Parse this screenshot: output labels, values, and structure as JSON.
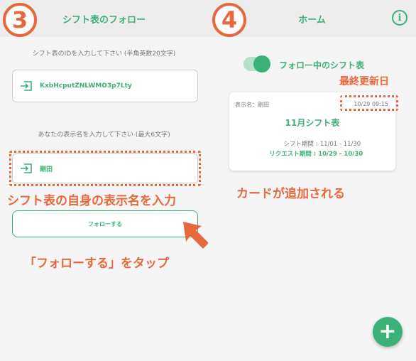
{
  "colors": {
    "accent": "#3bb078",
    "annotation": "#e8683e",
    "header_bg": "#ededed",
    "panel_bg": "#f5f5f5"
  },
  "left": {
    "step_number": "3",
    "header_title": "シフト表のフォロー",
    "back_icon": "chevron-left-icon",
    "id_field_label": "シフト表のIDを入力して下さい (半角英数20文字)",
    "id_value": "KxbHcputZNLWMO3p7Lty",
    "name_field_label": "あなたの表示名を入力して下さい (最大6文字)",
    "name_value": "剛田",
    "input_icon": "login-arrow-icon",
    "annotation_name": "シフト表の自身の表示名を入力",
    "follow_button_label": "フォローする",
    "annotation_tap": "「フォローする」をタップ"
  },
  "right": {
    "step_number": "4",
    "header_title": "ホーム",
    "info_icon": "info-icon",
    "toggle_label": "フォロー中のシフト表",
    "annotation_updated": "最終更新日",
    "card": {
      "name_label": "表示名：剛田",
      "updated": "10/29 09:15",
      "title": "11月シフト表",
      "shift_period_label": "シフト期間",
      "shift_period_value": "11/01 - 11/30",
      "request_period_label": "リクエスト期間",
      "request_period_value": "10/29 - 10/30"
    },
    "annotation_card": "カードが追加される",
    "fab_label": "+"
  }
}
